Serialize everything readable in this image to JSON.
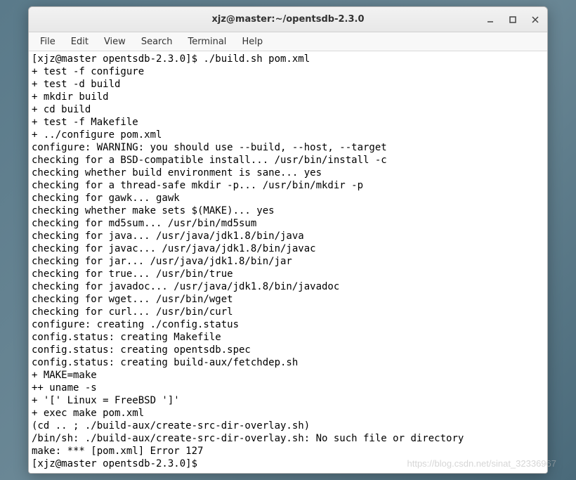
{
  "window": {
    "title": "xjz@master:~/opentsdb-2.3.0"
  },
  "menubar": {
    "items": [
      {
        "label": "File"
      },
      {
        "label": "Edit"
      },
      {
        "label": "View"
      },
      {
        "label": "Search"
      },
      {
        "label": "Terminal"
      },
      {
        "label": "Help"
      }
    ]
  },
  "terminal": {
    "lines": [
      "[xjz@master opentsdb-2.3.0]$ ./build.sh pom.xml",
      "+ test -f configure",
      "+ test -d build",
      "+ mkdir build",
      "+ cd build",
      "+ test -f Makefile",
      "+ ../configure pom.xml",
      "configure: WARNING: you should use --build, --host, --target",
      "checking for a BSD-compatible install... /usr/bin/install -c",
      "checking whether build environment is sane... yes",
      "checking for a thread-safe mkdir -p... /usr/bin/mkdir -p",
      "checking for gawk... gawk",
      "checking whether make sets $(MAKE)... yes",
      "checking for md5sum... /usr/bin/md5sum",
      "checking for java... /usr/java/jdk1.8/bin/java",
      "checking for javac... /usr/java/jdk1.8/bin/javac",
      "checking for jar... /usr/java/jdk1.8/bin/jar",
      "checking for true... /usr/bin/true",
      "checking for javadoc... /usr/java/jdk1.8/bin/javadoc",
      "checking for wget... /usr/bin/wget",
      "checking for curl... /usr/bin/curl",
      "configure: creating ./config.status",
      "config.status: creating Makefile",
      "config.status: creating opentsdb.spec",
      "config.status: creating build-aux/fetchdep.sh",
      "+ MAKE=make",
      "++ uname -s",
      "+ '[' Linux = FreeBSD ']'",
      "+ exec make pom.xml",
      "(cd .. ; ./build-aux/create-src-dir-overlay.sh)",
      "/bin/sh: ./build-aux/create-src-dir-overlay.sh: No such file or directory",
      "make: *** [pom.xml] Error 127",
      "[xjz@master opentsdb-2.3.0]$ "
    ]
  },
  "watermark": "https://blog.csdn.net/sinat_32336967"
}
